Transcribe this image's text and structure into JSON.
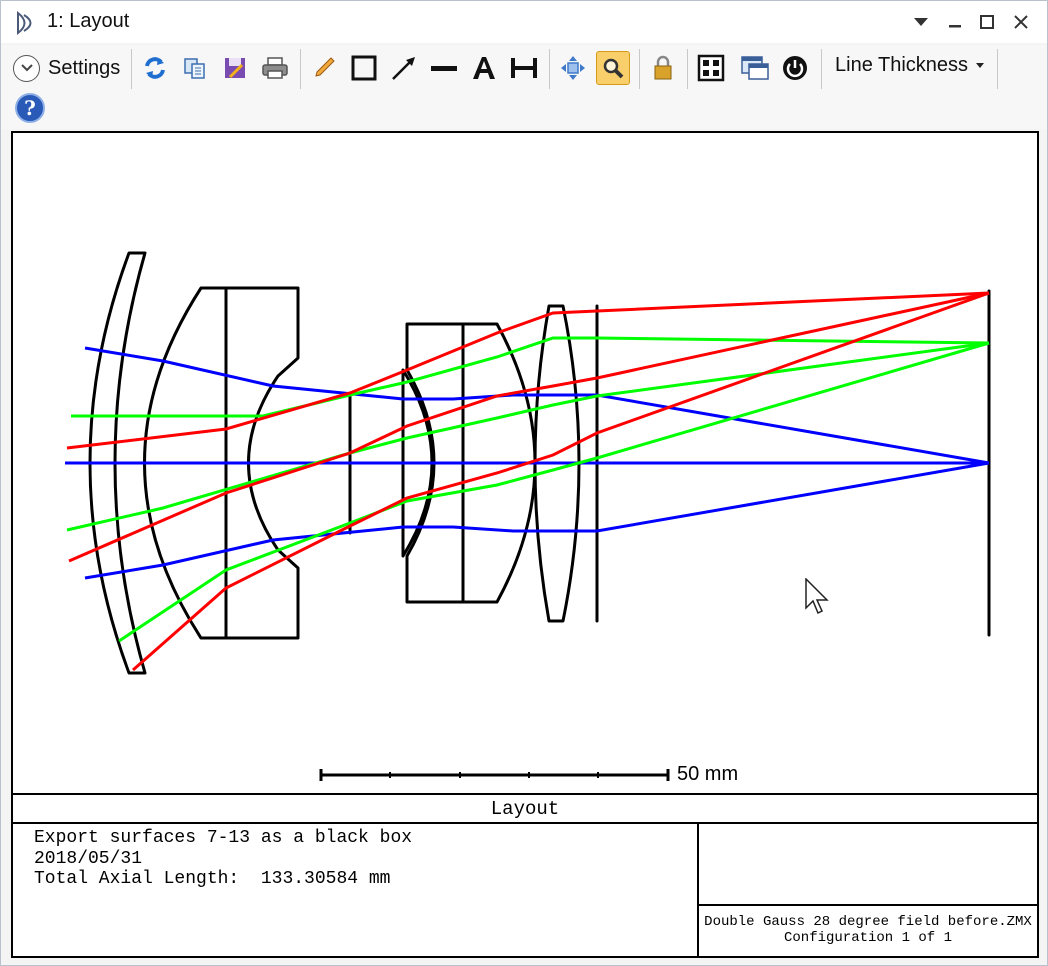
{
  "window": {
    "title": "1: Layout",
    "controls": {
      "menu": "▾",
      "minimize": "—",
      "maximize": "☐",
      "close": "✕"
    }
  },
  "toolbar": {
    "settings_label": "Settings",
    "line_thickness_label": "Line Thickness",
    "help_label": "?",
    "buttons": [
      "refresh-icon",
      "copy-icon",
      "save-icon",
      "print-icon",
      "pencil-icon",
      "rectangle-icon",
      "arrow-line-icon",
      "line-icon",
      "text-icon",
      "dimension-icon",
      "pan-icon",
      "zoom-icon",
      "lock-icon",
      "fit-icon",
      "window-icon",
      "power-icon"
    ],
    "active_button": "zoom-icon"
  },
  "plot": {
    "scale_bar_label": "50 mm",
    "caption": "Layout",
    "info_lines": [
      "Export surfaces 7-13 as a black box",
      "2018/05/31",
      "Total Axial Length:  133.30584 mm"
    ],
    "file_name": "Double Gauss 28 degree field before.ZMX",
    "configuration": "Configuration 1 of 1",
    "ray_colors": {
      "field_1": "#0000ff",
      "field_2": "#00ff00",
      "field_3": "#ff0000"
    }
  }
}
